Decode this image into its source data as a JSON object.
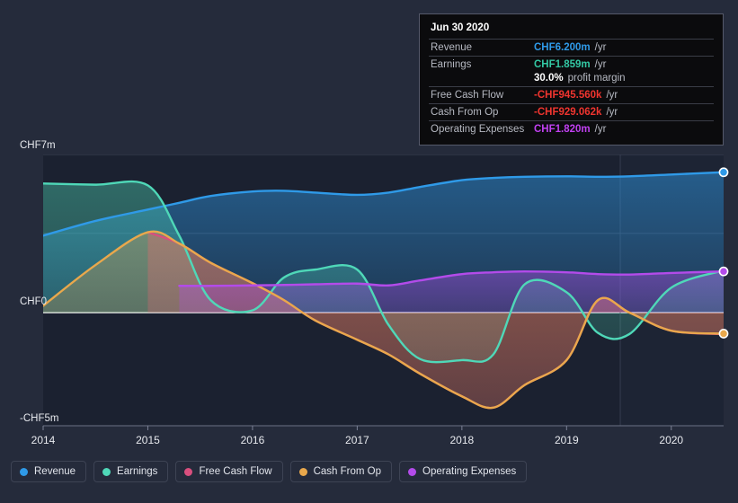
{
  "tooltip": {
    "date": "Jun 30 2020",
    "rows": [
      {
        "label": "Revenue",
        "value": "CHF6.200m",
        "unit": "/yr",
        "color": "#2f9ae8"
      },
      {
        "label": "Earnings",
        "value": "CHF1.859m",
        "unit": "/yr",
        "color": "#33c8a4"
      },
      {
        "label": "",
        "value": "30.0%",
        "unit": "profit margin",
        "color": "#ffffff"
      },
      {
        "label": "Free Cash Flow",
        "value": "-CHF945.560k",
        "unit": "/yr",
        "color": "#f0352f"
      },
      {
        "label": "Cash From Op",
        "value": "-CHF929.062k",
        "unit": "/yr",
        "color": "#f0352f"
      },
      {
        "label": "Operating Expenses",
        "value": "CHF1.820m",
        "unit": "/yr",
        "color": "#c040f0"
      }
    ]
  },
  "legend": {
    "items": [
      {
        "label": "Revenue",
        "color": "#2f9ae8"
      },
      {
        "label": "Earnings",
        "color": "#4fd8b8"
      },
      {
        "label": "Free Cash Flow",
        "color": "#d94f7e"
      },
      {
        "label": "Cash From Op",
        "color": "#e9a84c"
      },
      {
        "label": "Operating Expenses",
        "color": "#b34bea"
      }
    ]
  },
  "axes": {
    "y_ticks": [
      {
        "label": "CHF7m",
        "value": 7
      },
      {
        "label": "CHF0",
        "value": 0
      },
      {
        "label": "-CHF5m",
        "value": -5
      }
    ],
    "x_ticks": [
      "2014",
      "2015",
      "2016",
      "2017",
      "2018",
      "2019",
      "2020"
    ]
  },
  "chart_data": {
    "type": "area",
    "title": "",
    "xlabel": "",
    "ylabel": "CHF",
    "ylim": [
      -5,
      7
    ],
    "xlim": [
      2014,
      2020.5
    ],
    "grid": true,
    "legend_position": "bottom",
    "currency": "CHF",
    "units": "millions",
    "x": [
      2014,
      2014.5,
      2015,
      2015.3,
      2015.6,
      2016,
      2016.3,
      2016.6,
      2017,
      2017.3,
      2017.6,
      2018,
      2018.3,
      2018.6,
      2019,
      2019.3,
      2019.6,
      2020,
      2020.5
    ],
    "series": [
      {
        "name": "Revenue",
        "color": "#2f9ae8",
        "values": [
          3.4,
          4.05,
          4.55,
          4.85,
          5.15,
          5.35,
          5.38,
          5.3,
          5.2,
          5.3,
          5.55,
          5.85,
          5.95,
          6.0,
          6.02,
          6.0,
          6.02,
          6.1,
          6.2
        ]
      },
      {
        "name": "Earnings",
        "color": "#4fd8b8",
        "values": [
          5.7,
          5.65,
          5.62,
          3.4,
          0.55,
          0.1,
          1.55,
          1.9,
          1.9,
          -0.55,
          -2.05,
          -2.1,
          -1.85,
          1.25,
          0.9,
          -0.9,
          -0.95,
          1.1,
          1.86
        ]
      },
      {
        "name": "Free Cash Flow",
        "color": "#d94f7e",
        "start_x": 2015,
        "values": [
          null,
          null,
          3.55,
          3.05,
          2.2,
          1.3,
          0.55,
          -0.35,
          -1.2,
          -1.85,
          -2.7,
          -3.7,
          -4.2,
          -3.2,
          -2.1,
          0.55,
          0.0,
          -0.8,
          -0.95
        ]
      },
      {
        "name": "Cash From Op",
        "color": "#e9a84c",
        "values": [
          0.3,
          2.1,
          3.55,
          3.05,
          2.2,
          1.3,
          0.55,
          -0.35,
          -1.2,
          -1.85,
          -2.7,
          -3.7,
          -4.2,
          -3.2,
          -2.1,
          0.55,
          0.0,
          -0.8,
          -0.93
        ]
      },
      {
        "name": "Operating Expenses",
        "color": "#b34bea",
        "start_x": 2015.45,
        "values": [
          null,
          null,
          null,
          1.18,
          1.18,
          1.2,
          1.22,
          1.25,
          1.28,
          1.2,
          1.42,
          1.7,
          1.78,
          1.82,
          1.78,
          1.7,
          1.68,
          1.75,
          1.82
        ]
      }
    ],
    "markers": [
      {
        "series": "Revenue",
        "x": 2020.5,
        "y": 6.2
      },
      {
        "series": "Operating Expenses",
        "x": 2020.5,
        "y": 1.82
      },
      {
        "series": "Cash From Op",
        "x": 2020.5,
        "y": -0.93
      }
    ]
  }
}
